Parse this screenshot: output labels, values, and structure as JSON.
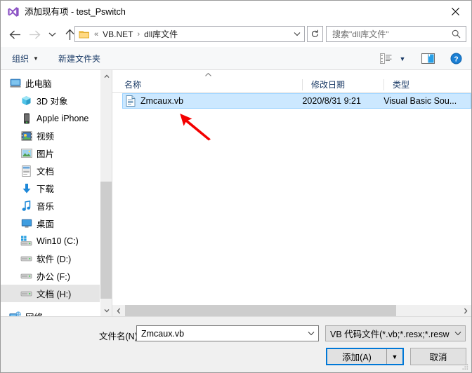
{
  "window": {
    "title": "添加现有项 - test_Pswitch",
    "app_icon": "visual-studio-icon",
    "close_label": "✕"
  },
  "nav": {
    "back_icon": "arrow-left-icon",
    "forward_icon": "arrow-right-icon",
    "recent_icon": "chevron-down-icon",
    "up_icon": "arrow-up-icon",
    "refresh_icon": "refresh-icon",
    "address": {
      "folder_icon": "folder-icon",
      "prefix": "«",
      "crumbs": [
        "VB.NET",
        "dll库文件"
      ],
      "separator": "›",
      "dropdown_icon": "chevron-down-icon"
    },
    "search": {
      "placeholder": "搜索\"dll库文件\"",
      "icon": "search-icon"
    }
  },
  "toolbar": {
    "organize_label": "组织",
    "organize_caret": "▼",
    "new_folder_label": "新建文件夹",
    "view_icon": "view-list-icon",
    "view_caret": "▼",
    "preview_icon": "preview-pane-icon",
    "help_icon": "help-icon"
  },
  "sidebar": {
    "items": [
      {
        "label": "此电脑",
        "icon": "this-pc-icon",
        "level": 0,
        "selected": false
      },
      {
        "label": "3D 对象",
        "icon": "3d-objects-icon",
        "level": 1,
        "selected": false
      },
      {
        "label": "Apple iPhone",
        "icon": "iphone-icon",
        "level": 1,
        "selected": false
      },
      {
        "label": "视频",
        "icon": "videos-icon",
        "level": 1,
        "selected": false
      },
      {
        "label": "图片",
        "icon": "pictures-icon",
        "level": 1,
        "selected": false
      },
      {
        "label": "文档",
        "icon": "documents-icon",
        "level": 1,
        "selected": false
      },
      {
        "label": "下载",
        "icon": "downloads-icon",
        "level": 1,
        "selected": false
      },
      {
        "label": "音乐",
        "icon": "music-icon",
        "level": 1,
        "selected": false
      },
      {
        "label": "桌面",
        "icon": "desktop-icon",
        "level": 1,
        "selected": false
      },
      {
        "label": "Win10 (C:)",
        "icon": "system-drive-icon",
        "level": 1,
        "selected": false
      },
      {
        "label": "软件 (D:)",
        "icon": "drive-icon",
        "level": 1,
        "selected": false
      },
      {
        "label": "办公 (F:)",
        "icon": "drive-icon",
        "level": 1,
        "selected": false
      },
      {
        "label": "文档 (H:)",
        "icon": "drive-icon",
        "level": 1,
        "selected": true
      },
      {
        "label": "网络",
        "icon": "network-icon",
        "level": 0,
        "selected": false
      }
    ]
  },
  "filelist": {
    "sort_indicator": "⌃",
    "columns": [
      {
        "label": "名称"
      },
      {
        "label": "修改日期"
      },
      {
        "label": "类型"
      }
    ],
    "rows": [
      {
        "icon": "vb-file-icon",
        "name": "Zmcaux.vb",
        "modified": "2020/8/31 9:21",
        "type": "Visual Basic Sou...",
        "selected": true
      }
    ]
  },
  "annotation": {
    "arrow_color": "#f40000",
    "arrow_name": "red-pointer-arrow"
  },
  "scrollbars": {
    "sidebar_up": "⌃",
    "sidebar_down": "⌄",
    "hscroll_left": "❮",
    "hscroll_right": "❯"
  },
  "footer": {
    "filename_label": "文件名(N):",
    "filename_value": "Zmcaux.vb",
    "filename_caret": "⌄",
    "filter_value": "VB 代码文件(*.vb;*.resx;*.resw",
    "filter_caret": "⌄",
    "add_label": "添加(A)",
    "add_caret": "▼",
    "cancel_label": "取消"
  },
  "colors": {
    "accent": "#0078d7",
    "selection": "#cce8ff",
    "toolbar_text": "#1a3a66",
    "annotation_red": "#f40000"
  }
}
